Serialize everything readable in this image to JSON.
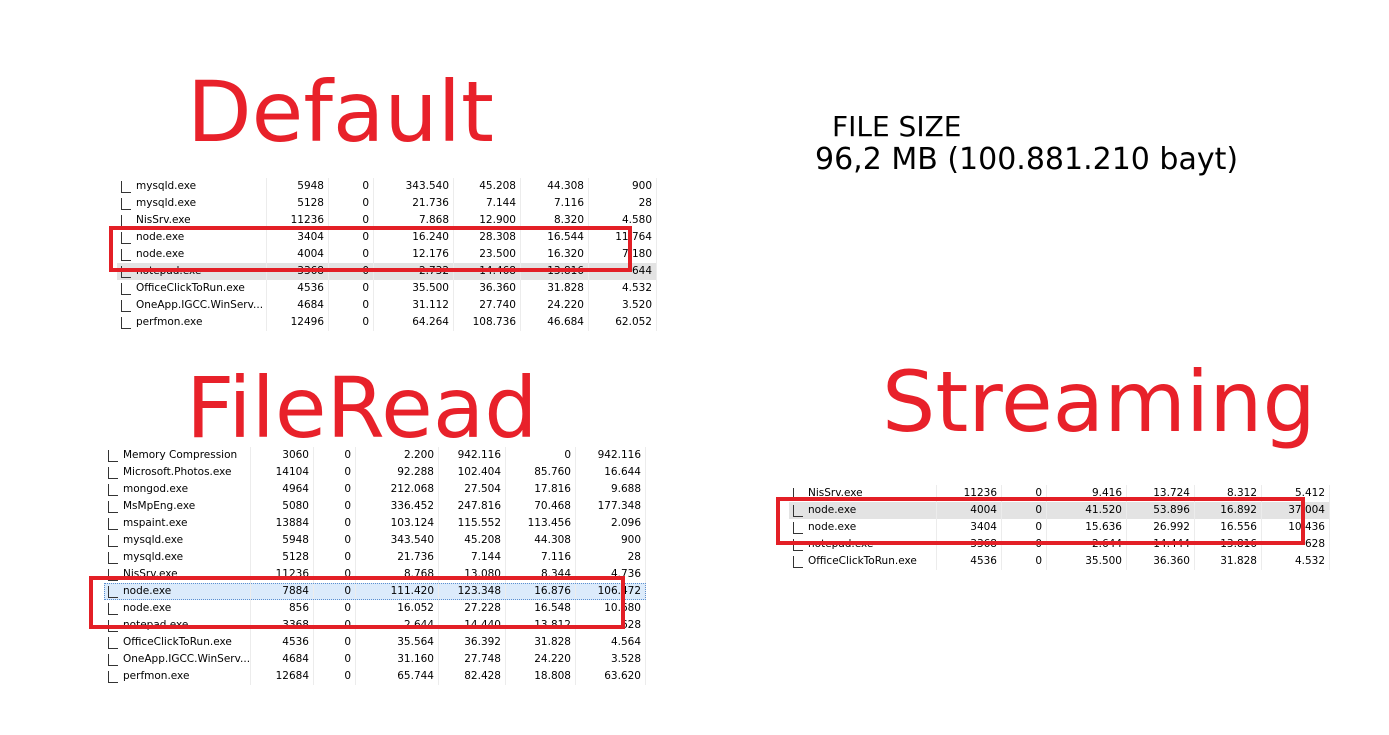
{
  "headings": {
    "default": "Default",
    "fileread": "FileRead",
    "streaming": "Streaming"
  },
  "file_size": {
    "label": "FILE SIZE",
    "value": "96,2 MB (100.881.210 bayt)"
  },
  "default_rows": [
    [
      "mysqld.exe",
      "5948",
      "0",
      "343.540",
      "45.208",
      "44.308",
      "900"
    ],
    [
      "mysqld.exe",
      "5128",
      "0",
      "21.736",
      "7.144",
      "7.116",
      "28"
    ],
    [
      "NisSrv.exe",
      "11236",
      "0",
      "7.868",
      "12.900",
      "8.320",
      "4.580"
    ],
    [
      "node.exe",
      "3404",
      "0",
      "16.240",
      "28.308",
      "16.544",
      "11.764"
    ],
    [
      "node.exe",
      "4004",
      "0",
      "12.176",
      "23.500",
      "16.320",
      "7.180"
    ],
    [
      "notepad.exe",
      "3368",
      "0",
      "2.732",
      "14.468",
      "13.816",
      "644"
    ],
    [
      "OfficeClickToRun.exe",
      "4536",
      "0",
      "35.500",
      "36.360",
      "31.828",
      "4.532"
    ],
    [
      "OneApp.IGCC.WinServ...",
      "4684",
      "0",
      "31.112",
      "27.740",
      "24.220",
      "3.520"
    ],
    [
      "perfmon.exe",
      "12496",
      "0",
      "64.264",
      "108.736",
      "46.684",
      "62.052"
    ]
  ],
  "fileread_rows": [
    [
      "Memory Compression",
      "3060",
      "0",
      "2.200",
      "942.116",
      "0",
      "942.116"
    ],
    [
      "Microsoft.Photos.exe",
      "14104",
      "0",
      "92.288",
      "102.404",
      "85.760",
      "16.644"
    ],
    [
      "mongod.exe",
      "4964",
      "0",
      "212.068",
      "27.504",
      "17.816",
      "9.688"
    ],
    [
      "MsMpEng.exe",
      "5080",
      "0",
      "336.452",
      "247.816",
      "70.468",
      "177.348"
    ],
    [
      "mspaint.exe",
      "13884",
      "0",
      "103.124",
      "115.552",
      "113.456",
      "2.096"
    ],
    [
      "mysqld.exe",
      "5948",
      "0",
      "343.540",
      "45.208",
      "44.308",
      "900"
    ],
    [
      "mysqld.exe",
      "5128",
      "0",
      "21.736",
      "7.144",
      "7.116",
      "28"
    ],
    [
      "NisSrv.exe",
      "11236",
      "0",
      "8.768",
      "13.080",
      "8.344",
      "4.736"
    ],
    [
      "node.exe",
      "7884",
      "0",
      "111.420",
      "123.348",
      "16.876",
      "106.472"
    ],
    [
      "node.exe",
      "856",
      "0",
      "16.052",
      "27.228",
      "16.548",
      "10.680"
    ],
    [
      "notepad.exe",
      "3368",
      "0",
      "2.644",
      "14.440",
      "13.812",
      "628"
    ],
    [
      "OfficeClickToRun.exe",
      "4536",
      "0",
      "35.564",
      "36.392",
      "31.828",
      "4.564"
    ],
    [
      "OneApp.IGCC.WinServ...",
      "4684",
      "0",
      "31.160",
      "27.748",
      "24.220",
      "3.528"
    ],
    [
      "perfmon.exe",
      "12684",
      "0",
      "65.744",
      "82.428",
      "18.808",
      "63.620"
    ]
  ],
  "streaming_rows": [
    [
      "NisSrv.exe",
      "11236",
      "0",
      "9.416",
      "13.724",
      "8.312",
      "5.412"
    ],
    [
      "node.exe",
      "4004",
      "0",
      "41.520",
      "53.896",
      "16.892",
      "37.004"
    ],
    [
      "node.exe",
      "3404",
      "0",
      "15.636",
      "26.992",
      "16.556",
      "10.436"
    ],
    [
      "notepad.exe",
      "3368",
      "0",
      "2.644",
      "14.444",
      "13.816",
      "628"
    ],
    [
      "OfficeClickToRun.exe",
      "4536",
      "0",
      "35.500",
      "36.360",
      "31.828",
      "4.532"
    ]
  ]
}
